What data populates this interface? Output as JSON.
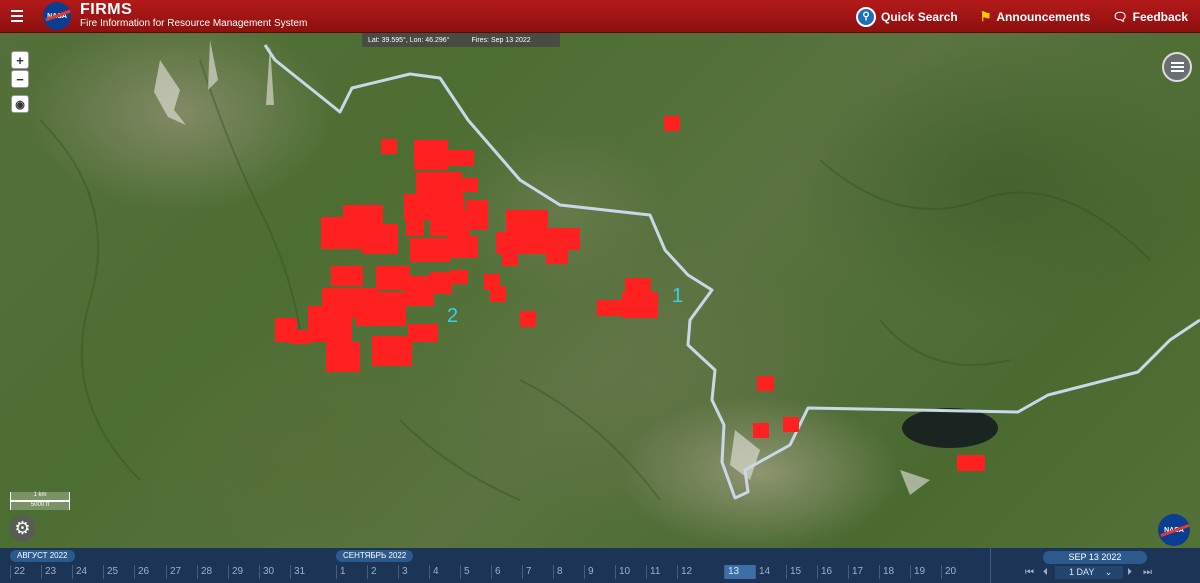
{
  "header": {
    "logo_text": "NASA",
    "title": "FIRMS",
    "subtitle": "Fire Information for Resource Management System",
    "quick_search": "Quick Search",
    "announcements": "Announcements",
    "feedback": "Feedback"
  },
  "map": {
    "coords": "Lat: 39.595°, Lon: 46.296°",
    "fires_date": "Fires: Sep 13 2022",
    "zoom_in": "+",
    "zoom_out": "−",
    "scale_km": "1 km",
    "scale_ft": "5000 ft",
    "label_1": "1",
    "label_2": "2",
    "corner_logo": "NASA"
  },
  "timeline": {
    "month_1": "АВГУСТ 2022",
    "month_2": "СЕНТЯБРЬ 2022",
    "days": [
      "22",
      "23",
      "24",
      "25",
      "26",
      "27",
      "28",
      "29",
      "30",
      "31",
      "1",
      "2",
      "3",
      "4",
      "5",
      "6",
      "7",
      "8",
      "9",
      "10",
      "11",
      "12",
      "13",
      "14",
      "15",
      "16",
      "17",
      "18",
      "19",
      "20"
    ],
    "selected_day": "13",
    "selected_date": "SEP 13 2022",
    "time_span": "1 DAY"
  },
  "colors": {
    "header_red": "#a01414",
    "fire_red": "#ff2020",
    "border_line": "#c8d8e8",
    "timeline_bg": "#1c3556",
    "label_cyan": "#39d0e6"
  }
}
